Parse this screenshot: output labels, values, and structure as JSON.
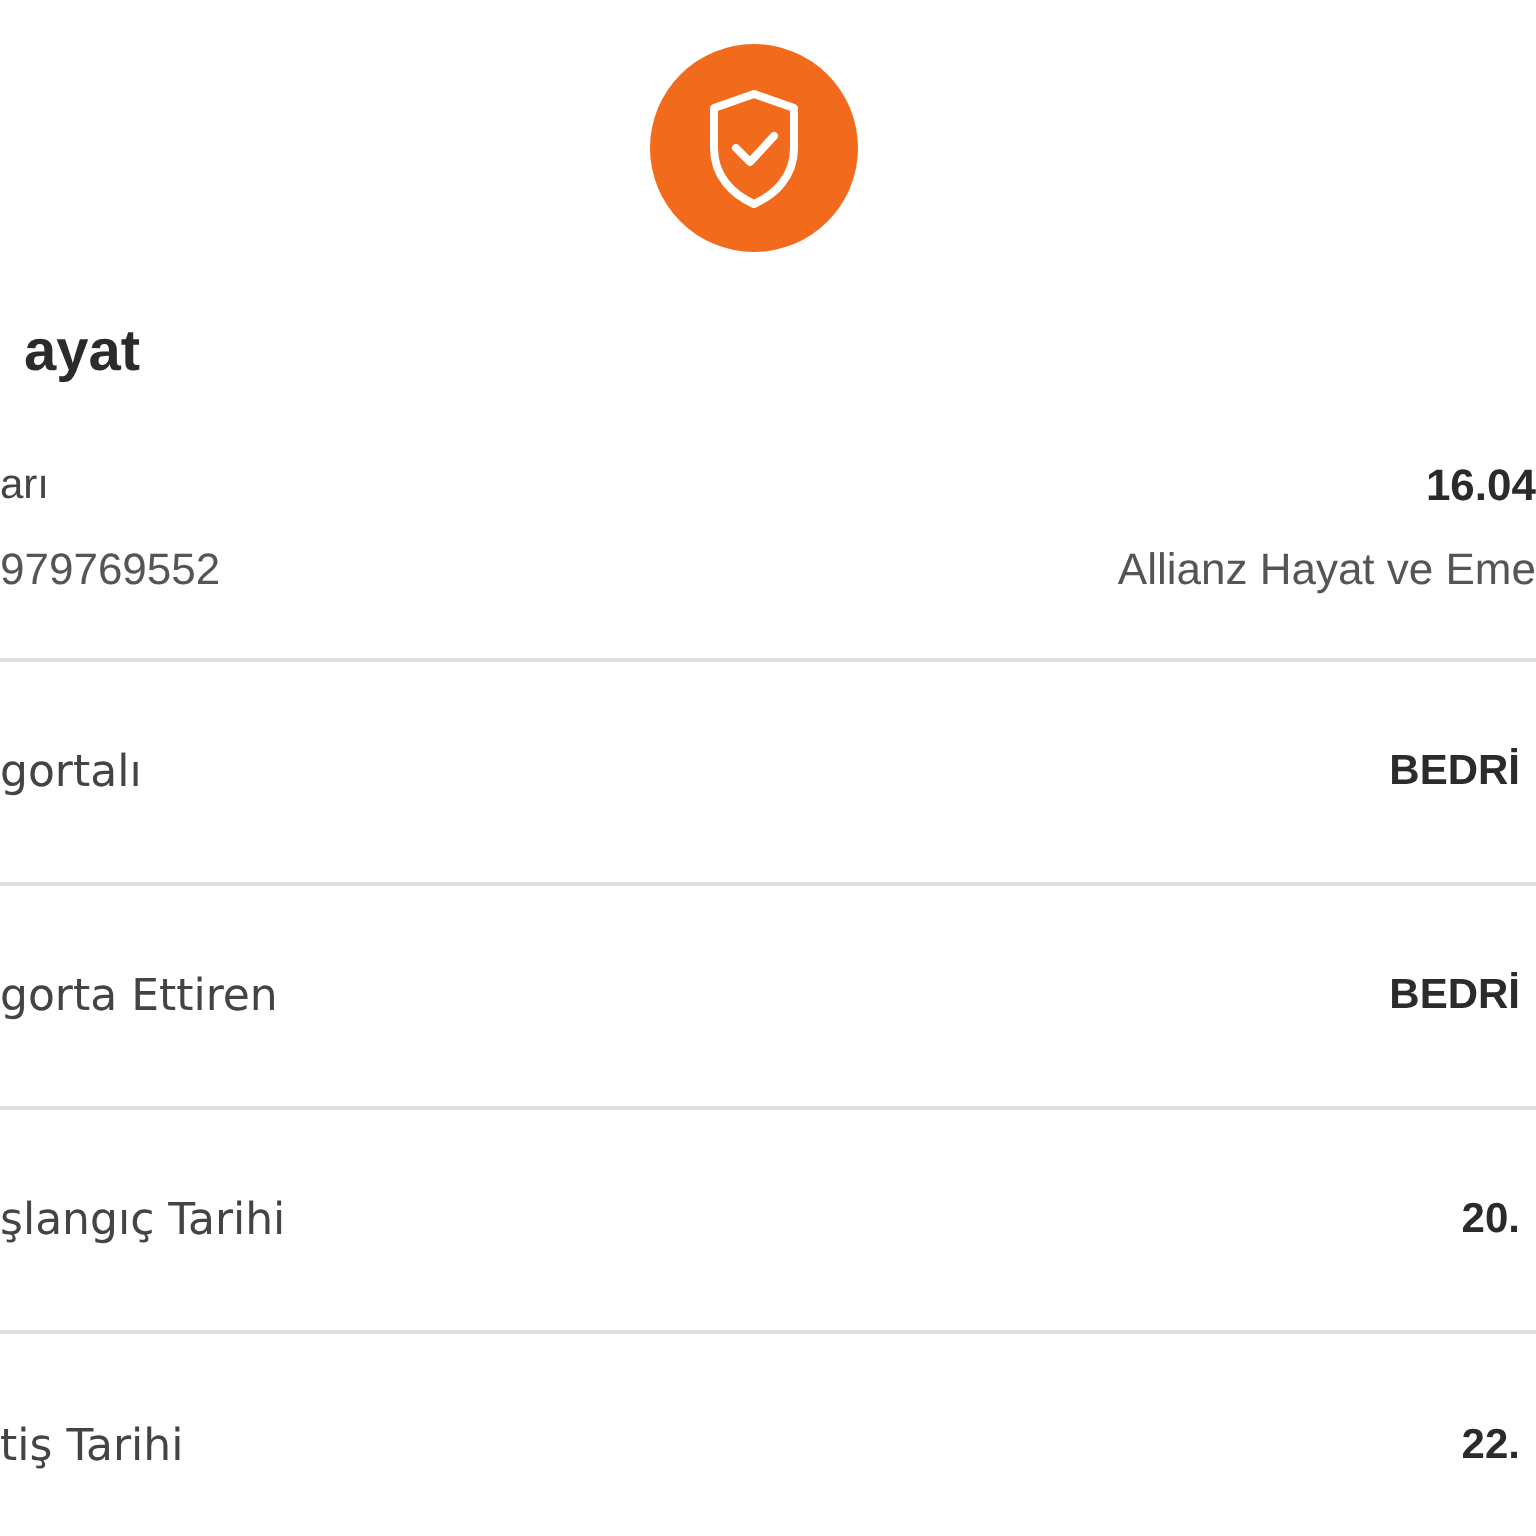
{
  "header": {
    "title": "ayat",
    "label": "arı",
    "policy_number": "979769552",
    "date": "16.04",
    "company": "Allianz Hayat ve Eme"
  },
  "rows": [
    {
      "label": "gortalı",
      "value": "BEDRİ"
    },
    {
      "label": "gorta Ettiren",
      "value": "BEDRİ"
    },
    {
      "label": "şlangıç Tarihi",
      "value": "20."
    },
    {
      "label": "tiş Tarihi",
      "value": "22."
    }
  ]
}
